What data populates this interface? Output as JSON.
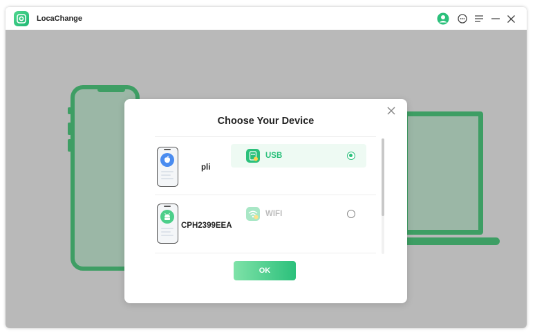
{
  "app": {
    "title": "LocaChange",
    "logo_icon": "location-pin-icon",
    "accent_color": "#2bc07b"
  },
  "titlebar_icons": [
    "avatar-icon",
    "chat-icon",
    "menu-icon",
    "minimize-icon",
    "close-icon"
  ],
  "modal": {
    "title": "Choose Your Device",
    "ok_label": "OK",
    "devices": [
      {
        "name": "pli",
        "os_icon": "apple-icon",
        "connection": {
          "label": "USB",
          "icon": "usb-icon",
          "selected": true
        }
      },
      {
        "name": "CPH2399EEA",
        "os_icon": "android-icon",
        "connection": {
          "label": "WIFI",
          "icon": "wifi-icon",
          "selected": false
        }
      }
    ]
  }
}
